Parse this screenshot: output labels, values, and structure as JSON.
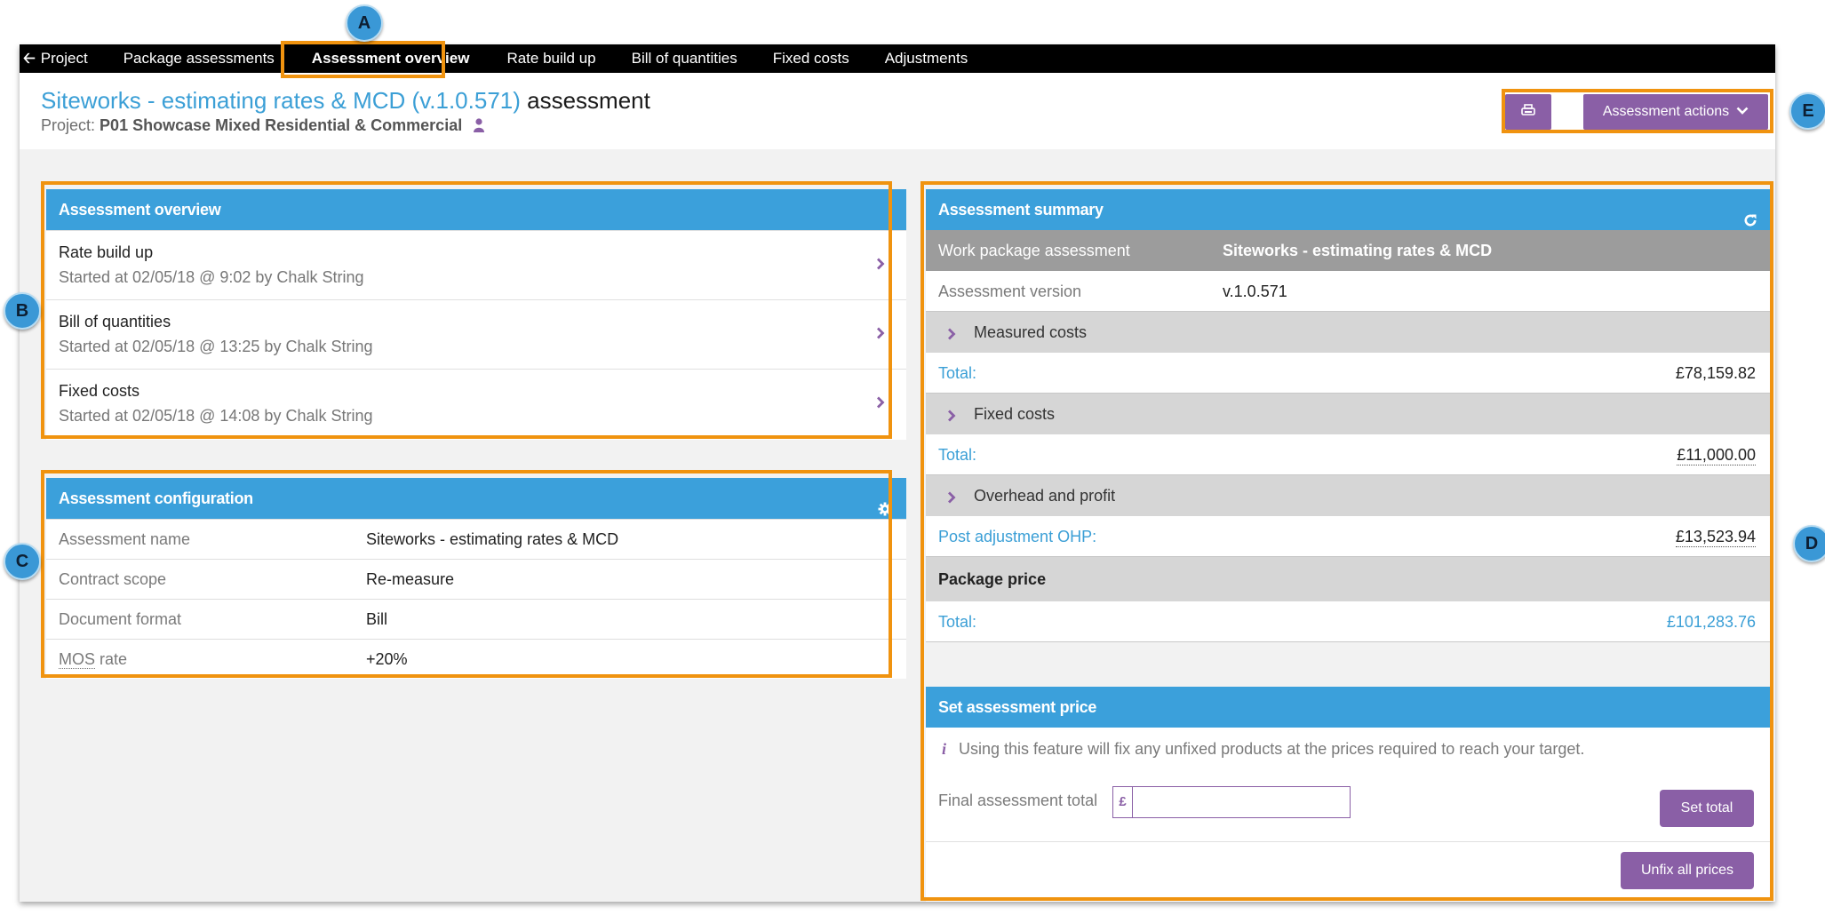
{
  "nav": {
    "back_label": "Project",
    "items": [
      "Package assessments",
      "Assessment overview",
      "Rate build up",
      "Bill of quantities",
      "Fixed costs",
      "Adjustments"
    ],
    "active_index": 1
  },
  "header": {
    "title_link": "Siteworks - estimating rates & MCD (v.1.0.571)",
    "title_suffix": "assessment",
    "project_label": "Project:",
    "project_name": "P01 Showcase Mixed Residential & Commercial",
    "actions_label": "Assessment actions"
  },
  "overview": {
    "heading": "Assessment overview",
    "rows": [
      {
        "title": "Rate build up",
        "subtitle": "Started at 02/05/18 @ 9:02 by Chalk String"
      },
      {
        "title": "Bill of quantities",
        "subtitle": "Started at 02/05/18 @ 13:25 by Chalk String"
      },
      {
        "title": "Fixed costs",
        "subtitle": "Started at 02/05/18 @ 14:08 by Chalk String"
      }
    ]
  },
  "config": {
    "heading": "Assessment configuration",
    "rows": [
      {
        "label": "Assessment name",
        "value": "Siteworks - estimating rates & MCD"
      },
      {
        "label": "Contract scope",
        "value": "Re-measure"
      },
      {
        "label": "Document format",
        "value": "Bill"
      },
      {
        "label_abbr": "MOS",
        "label_rest": " rate",
        "value": "+20%"
      }
    ]
  },
  "summary": {
    "heading": "Assessment summary",
    "work_package_label": "Work package assessment",
    "work_package_value": "Siteworks - estimating rates & MCD",
    "version_label": "Assessment version",
    "version_value": "v.1.0.571",
    "measured_label": "Measured costs",
    "measured_total_label": "Total:",
    "measured_total": "£78,159.82",
    "fixed_label": "Fixed costs",
    "fixed_total_label": "Total:",
    "fixed_total": "£11,000.00",
    "ohp_label": "Overhead and profit",
    "ohp_total_label": "Post adjustment OHP:",
    "ohp_total": "£13,523.94",
    "package_label": "Package price",
    "package_total_label": "Total:",
    "package_total": "£101,283.76"
  },
  "set_price": {
    "heading": "Set assessment price",
    "info": "Using this feature will fix any unfixed products at the prices required to reach your target.",
    "final_label": "Final assessment total",
    "currency_symbol": "£",
    "input_value": "",
    "set_total_label": "Set total",
    "unfix_label": "Unfix all prices"
  },
  "callouts": [
    "A",
    "B",
    "C",
    "D",
    "E"
  ],
  "colors": {
    "nav_bg": "#000000",
    "panel_header": "#3ba0db",
    "accent_purple": "#8a5fa6",
    "link_blue": "#3b9fd6",
    "highlight_orange": "#f0930f"
  }
}
